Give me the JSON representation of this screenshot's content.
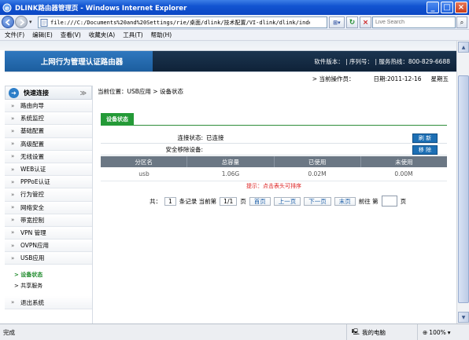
{
  "window": {
    "title": "DLINK路由器管理页 - Windows Internet Explorer",
    "controls": [
      "_",
      "□",
      "×"
    ]
  },
  "address_bar": {
    "url": "file:///C:/Documents%20and%20Settings/rie/桌面/dlink/技术配置/VI-dlink/dlink/index.htm#",
    "search_placeholder": "Live Search"
  },
  "menu_bar": {
    "items": [
      "文件(F)",
      "编辑(E)",
      "查看(V)",
      "收藏夹(A)",
      "工具(T)",
      "帮助(H)"
    ]
  },
  "header": {
    "product_title": "上网行为管理认证路由器",
    "info": "软件版本： | 序列号： | 服务热线：800-829-6688",
    "operator": "> 当前操作员：",
    "date": "日期:2011-12-16",
    "weekday": "星期五"
  },
  "sidebar": {
    "quick_link": "快速连接",
    "items": [
      "路由向导",
      "系统监控",
      "基础配置",
      "高级配置",
      "无线设置",
      "WEB认证",
      "PPPoE认证",
      "行为管控",
      "网络安全",
      "带宽控制",
      "VPN 管理",
      "OVPN应用",
      "USB应用"
    ],
    "subitems": [
      {
        "label": "> 设备状态",
        "active": true
      },
      {
        "label": "> 共享服务",
        "active": false
      }
    ],
    "logout": "退出系统"
  },
  "main": {
    "location": "当前位置：USB应用 > 设备状态",
    "tab": "设备状态",
    "connection_label": "连接状态:",
    "connection_value": "已连接",
    "refresh_button": "刷 新",
    "remove_label": "安全移除设备:",
    "remove_button": "移 除",
    "table": {
      "headers": [
        "分区名",
        "总容量",
        "已使用",
        "未使用"
      ],
      "rows": [
        [
          "usb",
          "1.06G",
          "0.02M",
          "0.00M"
        ]
      ]
    },
    "tip": "提示：点击表头可排序",
    "pager": {
      "total_prefix": "共：",
      "total": "1",
      "total_suffix": "条记录 当前第",
      "current": "1/1",
      "page_suffix": "页",
      "first": "首页",
      "prev": "上一页",
      "next": "下一页",
      "last": "末页",
      "goto_prefix": "前往 第",
      "goto_suffix": "页"
    }
  },
  "status_bar": {
    "text": "完成",
    "zone": "我的电脑",
    "zoom": "100%"
  }
}
